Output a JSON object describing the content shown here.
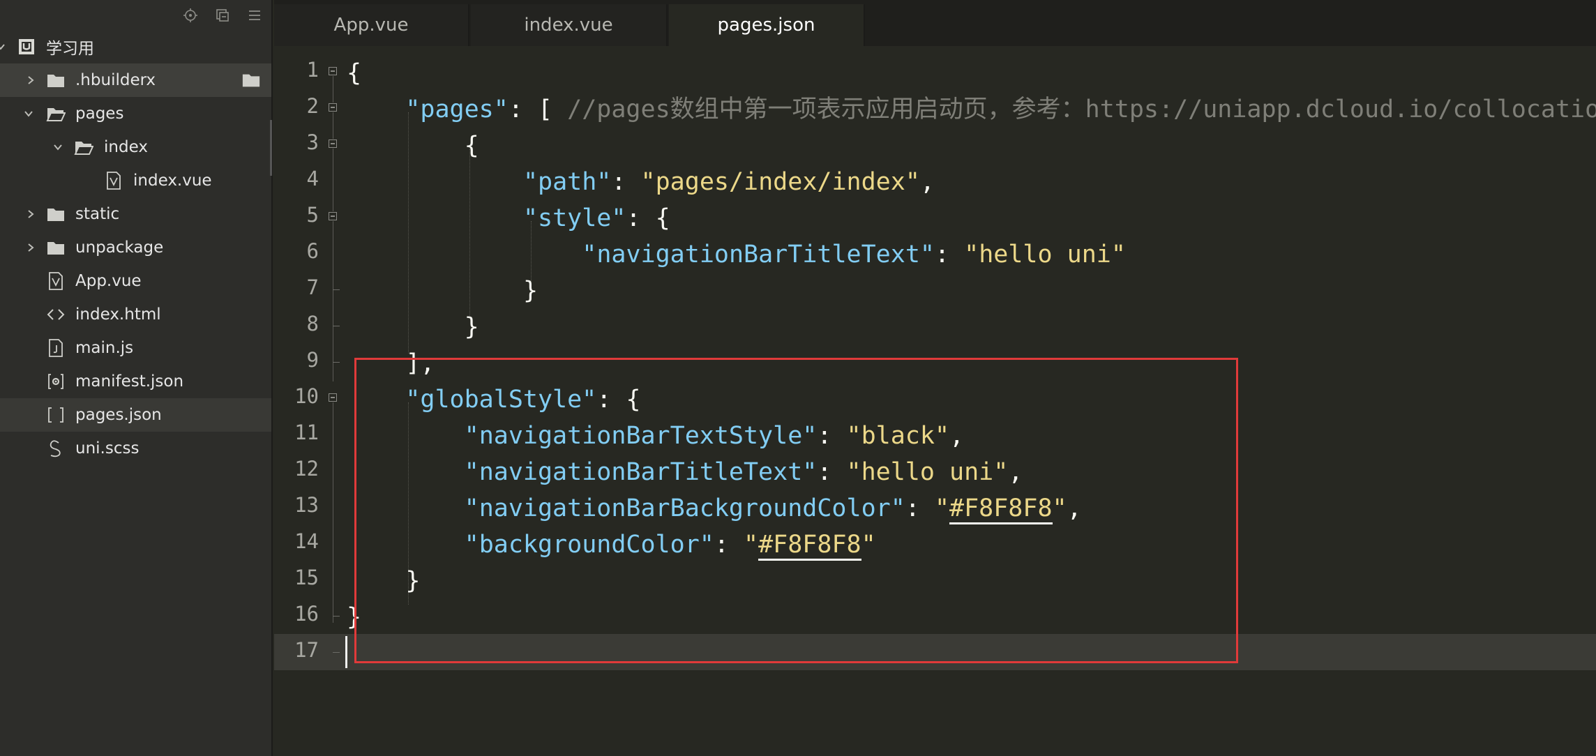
{
  "sidebar": {
    "toolbar": [
      {
        "icon": "crosshair-icon"
      },
      {
        "icon": "collapse-all-icon"
      },
      {
        "icon": "menu-icon"
      }
    ],
    "tree": [
      {
        "label": "学习用",
        "icon": "project-icon",
        "chevron": "down",
        "depth": 0
      },
      {
        "label": ".hbuilderx",
        "icon": "folder-icon",
        "chevron": "right",
        "depth": 1,
        "selected": true
      },
      {
        "label": "pages",
        "icon": "folder-open-icon",
        "chevron": "down",
        "depth": 1
      },
      {
        "label": "index",
        "icon": "folder-open-icon",
        "chevron": "down",
        "depth": 2
      },
      {
        "label": "index.vue",
        "icon": "vue-file-icon",
        "chevron": "",
        "depth": 3
      },
      {
        "label": "static",
        "icon": "folder-icon",
        "chevron": "right",
        "depth": 1
      },
      {
        "label": "unpackage",
        "icon": "folder-icon",
        "chevron": "right",
        "depth": 1
      },
      {
        "label": "App.vue",
        "icon": "vue-file-icon",
        "chevron": "",
        "depth": 1
      },
      {
        "label": "index.html",
        "icon": "html-file-icon",
        "chevron": "",
        "depth": 1
      },
      {
        "label": "main.js",
        "icon": "js-file-icon",
        "chevron": "",
        "depth": 1
      },
      {
        "label": "manifest.json",
        "icon": "manifest-file-icon",
        "chevron": "",
        "depth": 1
      },
      {
        "label": "pages.json",
        "icon": "json-file-icon",
        "chevron": "",
        "depth": 1,
        "current": true
      },
      {
        "label": "uni.scss",
        "icon": "scss-file-icon",
        "chevron": "",
        "depth": 1
      }
    ]
  },
  "tabs": [
    {
      "label": "App.vue",
      "active": false
    },
    {
      "label": "index.vue",
      "active": false
    },
    {
      "label": "pages.json",
      "active": true
    }
  ],
  "editor": {
    "line_numbers": [
      "1",
      "2",
      "3",
      "4",
      "5",
      "6",
      "7",
      "8",
      "9",
      "10",
      "11",
      "12",
      "13",
      "14",
      "15",
      "16",
      "17"
    ],
    "lines": [
      "{",
      "    \"pages\": [ //pages数组中第一项表示应用启动页，参考：https://uniapp.dcloud.io/collocation/pages",
      "        {",
      "            \"path\": \"pages/index/index\",",
      "            \"style\": {",
      "                \"navigationBarTitleText\": \"hello uni\"",
      "            }",
      "        }",
      "    ],",
      "    \"globalStyle\": {",
      "        \"navigationBarTextStyle\": \"black\",",
      "        \"navigationBarTitleText\": \"hello uni\",",
      "        \"navigationBarBackgroundColor\": \"#F8F8F8\",",
      "        \"backgroundColor\": \"#F8F8F8\"",
      "    }",
      "}",
      ""
    ],
    "current_line": 17
  },
  "colors": {
    "background": "#272822",
    "key": "#82cdf3",
    "string": "#ecd889",
    "comment": "#7f7f78",
    "highlight_box": "#e03a3a"
  }
}
